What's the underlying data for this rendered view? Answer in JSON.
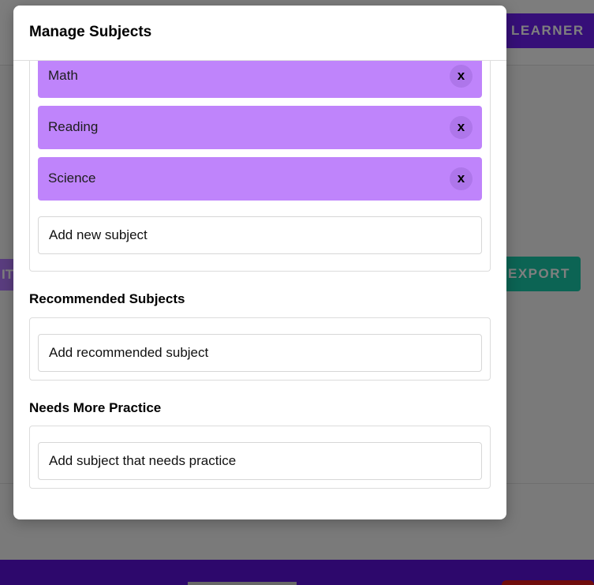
{
  "background": {
    "learner_button": "LEARNER",
    "left_button_fragment": "IT",
    "export_button": "EXPORT"
  },
  "modal": {
    "title": "Manage Subjects",
    "subjects": [
      {
        "label": "Math",
        "remove": "x"
      },
      {
        "label": "Reading",
        "remove": "x"
      },
      {
        "label": "Science",
        "remove": "x"
      }
    ],
    "add_subject_placeholder": "Add new subject",
    "recommended": {
      "heading": "Recommended Subjects",
      "placeholder": "Add recommended subject"
    },
    "needs_practice": {
      "heading": "Needs More Practice",
      "placeholder": "Add subject that needs practice"
    }
  },
  "colors": {
    "chip": "#bf84fb",
    "chip_remove": "#ae76ea",
    "primary": "#6d1ff0",
    "export": "#19c9a8"
  }
}
